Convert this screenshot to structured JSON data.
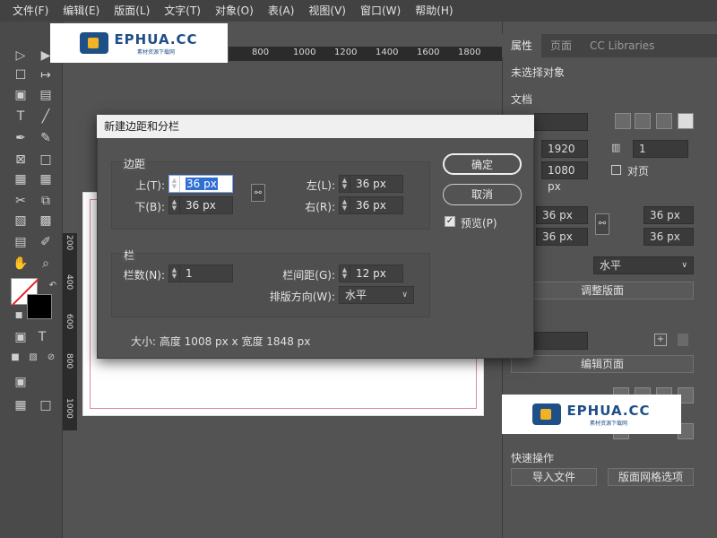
{
  "menubar": {
    "items": [
      "文件(F)",
      "编辑(E)",
      "版面(L)",
      "文字(T)",
      "对象(O)",
      "表(A)",
      "视图(V)",
      "窗口(W)",
      "帮助(H)"
    ]
  },
  "watermark": {
    "brand": "EPHUA.CC",
    "tagline": "素材资源下载网"
  },
  "ruler": {
    "top_labels": [
      "800",
      "1000",
      "1200",
      "1400",
      "1600",
      "1800"
    ],
    "left_labels": [
      "200",
      "400",
      "600",
      "800",
      "1000"
    ]
  },
  "right_panel": {
    "tabs": [
      "属性",
      "页面",
      "CC Libraries"
    ],
    "active_tab": "属性",
    "no_selection": "未选择对象",
    "document_label": "文档",
    "width_value": "1920 px",
    "height_value": "1080 px",
    "pages_value": "1",
    "facing_pages_label": "对页",
    "margin_values": [
      "36 px",
      "36 px",
      "36 px",
      "36 px"
    ],
    "direction_value": "水平",
    "adjust_layout_button": "调整版面",
    "edit_page_button": "编辑页面",
    "quick_actions_label": "快速操作",
    "import_file_button": "导入文件",
    "layout_grid_button": "版面网格选项"
  },
  "dialog": {
    "title": "新建边距和分栏",
    "margins_group": "边距",
    "top_label": "上(T):",
    "top_value": "36 px",
    "bottom_label": "下(B):",
    "bottom_value": "36 px",
    "left_label": "左(L):",
    "left_value": "36 px",
    "right_label": "右(R):",
    "right_value": "36 px",
    "columns_group": "栏",
    "columns_label": "栏数(N):",
    "columns_value": "1",
    "gutter_label": "栏间距(G):",
    "gutter_value": "12 px",
    "direction_label": "排版方向(W):",
    "direction_value": "水平",
    "size_text": "大小: 高度 1008 px x 宽度 1848 px",
    "ok_button": "确定",
    "cancel_button": "取消",
    "preview_label": "预览(P)",
    "preview_checked": true
  }
}
